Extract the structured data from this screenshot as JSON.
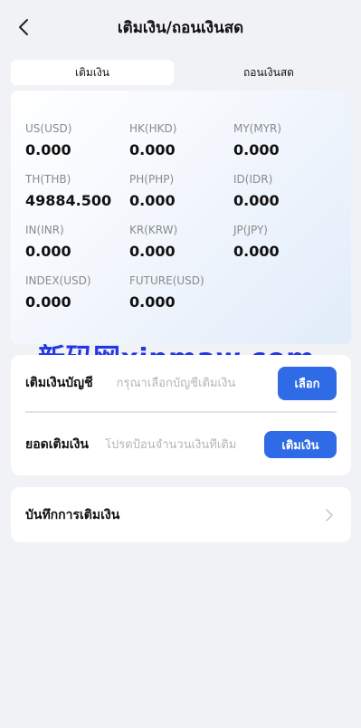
{
  "header": {
    "title": "เติมเงิน/ถอนเงินสด",
    "back_icon": "chevron-left-icon"
  },
  "tabs": [
    {
      "label": "เติมเงิน",
      "active": true
    },
    {
      "label": "ถอนเงินสด",
      "active": false
    }
  ],
  "balances": [
    {
      "currency": "US(USD)",
      "amount": "0.000"
    },
    {
      "currency": "HK(HKD)",
      "amount": "0.000"
    },
    {
      "currency": "MY(MYR)",
      "amount": "0.000"
    },
    {
      "currency": "TH(THB)",
      "amount": "49884.500"
    },
    {
      "currency": "PH(PHP)",
      "amount": "0.000"
    },
    {
      "currency": "ID(IDR)",
      "amount": "0.000"
    },
    {
      "currency": "IN(INR)",
      "amount": "0.000"
    },
    {
      "currency": "KR(KRW)",
      "amount": "0.000"
    },
    {
      "currency": "JP(JPY)",
      "amount": "0.000"
    },
    {
      "currency": "INDEX(USD)",
      "amount": "0.000"
    },
    {
      "currency": "FUTURE(USD)",
      "amount": "0.000"
    }
  ],
  "watermark": "新码网xinmaw.com",
  "form": {
    "account": {
      "label": "เติมเงินบัญชี",
      "value": "",
      "placeholder": "กรุณาเลือกบัญชีเติมเงิน",
      "button_label": "เลือก"
    },
    "amount": {
      "label": "ยอดเติมเงิน",
      "value": "",
      "placeholder": "โปรดป้อนจำนวนเงินที่เติม",
      "button_label": "เติมเงิน"
    }
  },
  "records": {
    "label": "บันทึกการเติมเงิน",
    "icon": "chevron-right-icon"
  },
  "colors": {
    "accent": "#2f6be6",
    "background": "#f1f2f6",
    "watermark": "#2236e8"
  }
}
